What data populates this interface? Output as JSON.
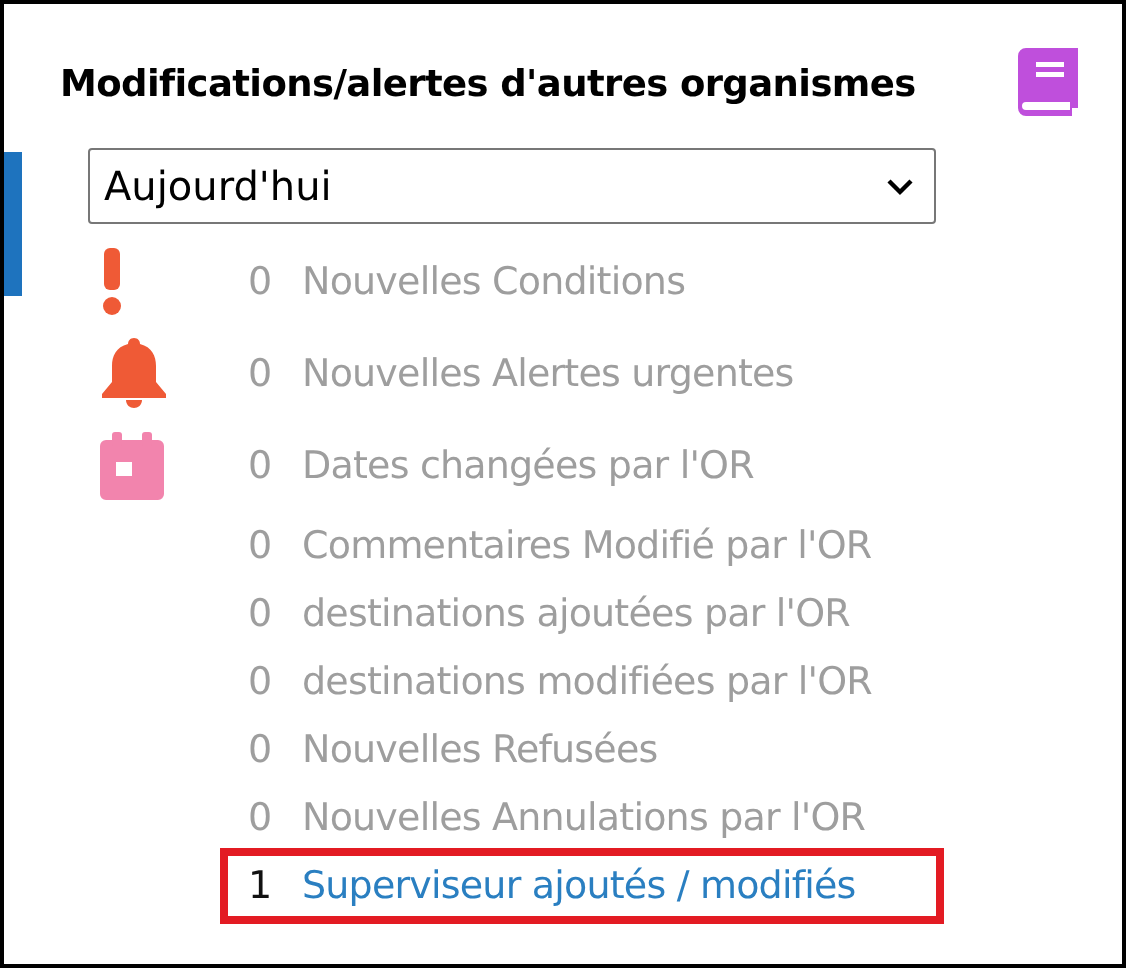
{
  "panel": {
    "title": "Modifications/alertes d'autres organismes",
    "period_select": {
      "value": "Aujourd'hui"
    },
    "rows": [
      {
        "kind": "exclamation",
        "count": "0",
        "label": "Nouvelles Conditions",
        "highlighted": false
      },
      {
        "kind": "bell",
        "count": "0",
        "label": "Nouvelles Alertes urgentes",
        "highlighted": false
      },
      {
        "kind": "calendar",
        "count": "0",
        "label": "Dates changées par l'OR",
        "highlighted": false
      },
      {
        "kind": "plain",
        "count": "0",
        "label": "Commentaires Modifié par l'OR",
        "highlighted": false
      },
      {
        "kind": "plain",
        "count": "0",
        "label": "destinations ajoutées par l'OR",
        "highlighted": false
      },
      {
        "kind": "plain",
        "count": "0",
        "label": "destinations modifiées par l'OR",
        "highlighted": false
      },
      {
        "kind": "plain",
        "count": "0",
        "label": "Nouvelles Refusées",
        "highlighted": false
      },
      {
        "kind": "plain",
        "count": "0",
        "label": "Nouvelles Annulations par l'OR",
        "highlighted": false
      },
      {
        "kind": "link",
        "count": "1",
        "label": "Superviseur ajoutés / modifiés",
        "highlighted": true
      }
    ]
  }
}
